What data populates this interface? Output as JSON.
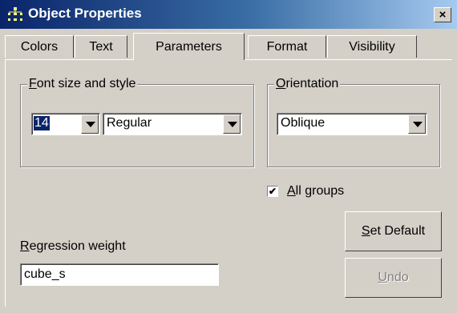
{
  "window": {
    "title": "Object Properties",
    "close_glyph": "×"
  },
  "tabs": [
    {
      "label": "Colors",
      "active": false
    },
    {
      "label": "Text",
      "active": false
    },
    {
      "label": "Parameters",
      "active": true
    },
    {
      "label": "Format",
      "active": false
    },
    {
      "label": "Visibility",
      "active": false
    }
  ],
  "font_group": {
    "label_mnemonic": "F",
    "label_rest": "ont size and style",
    "size_value": "14",
    "style_value": "Regular"
  },
  "orientation_group": {
    "label_mnemonic": "O",
    "label_rest": "rientation",
    "value": "Oblique"
  },
  "all_groups": {
    "mnemonic": "A",
    "rest": "ll groups",
    "checked": true,
    "check_glyph": "✔"
  },
  "regression_weight": {
    "label_mnemonic": "R",
    "label_rest": "egression weight",
    "value": "cube_s"
  },
  "buttons": {
    "set_default_mnemonic": "S",
    "set_default_rest": "et Default",
    "undo_mnemonic": "U",
    "undo_rest": "ndo"
  },
  "colors": {
    "title_bar_start": "#0a246a",
    "title_bar_end": "#a6caf0",
    "face": "#d4d0c8"
  }
}
